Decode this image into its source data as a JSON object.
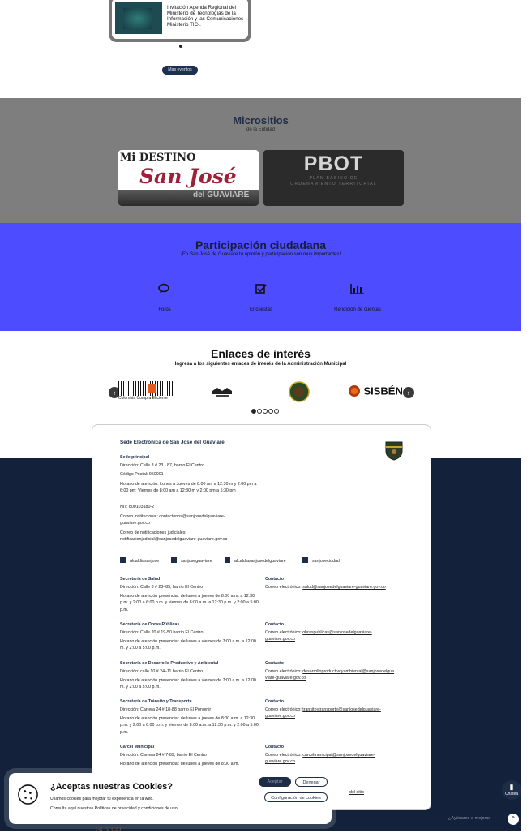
{
  "event": {
    "text": "Invitación Agenda Regional del Ministerio de Tecnologías de la Información y las Comunicaciones – Ministerio TIC-.",
    "more_label": "Mas eventos"
  },
  "microsites": {
    "title": "Micrositios",
    "subtitle": "de la Entidad",
    "card1": {
      "top": "Mi DESTINO",
      "main": "San José",
      "bottom": "del GUAVIARE"
    },
    "card2": {
      "main": "PBOT",
      "sub1": "PLAN BÁSICO DE",
      "sub2": "ORDENAMIENTO TERRITORIAL"
    }
  },
  "participation": {
    "title": "Participación ciudadana",
    "subtitle": "¡En San José de Guaviare tu opinión y participación son muy importantes!",
    "items": [
      {
        "icon": "chat-bubbles-icon",
        "label": "Foros"
      },
      {
        "icon": "checkbox-icon",
        "label": "Encuestas"
      },
      {
        "icon": "bar-chart-icon",
        "label": "Rendición de cuentas"
      }
    ]
  },
  "links": {
    "title": "Enlaces de interés",
    "subtitle": "Ingresa a los siguientes enlaces de interés de la Administración Municipal",
    "logo1": "Colombia Compra Eficiente",
    "logo4": "SISBÉN"
  },
  "footer": {
    "title": "Sede Electrónica de San José del Guaviare",
    "main_office": "Sede principal",
    "lines": [
      "Dirección: Calle 8 # 23 - 87, barrio El Centro",
      "Código Postal: 950001",
      "Horario de atención: Lunes a Jueves de 8:00 am a 12:30 m y 2:00 pm a 6:00 pm; Viernes de 8:00 am a 12:30 m y 2:00 pm a 5:30 pm",
      "NIT: 800103180-2",
      "Correo institucional: contactenos@sanjosedelguaviare-guaviare.gov.co",
      "Correo de notificaciones judiciales: notificacionjudicial@sanjosedelguaviare-guaviare.gov.co"
    ],
    "social": [
      "alcaldiasanjose",
      "sanjoseguaviare",
      "alcaldiasanjosedelguaviare",
      "sanjoseciudad"
    ],
    "offices": [
      {
        "name": "Secretaría de Salud",
        "address": "Dirección: Calle 8 # 23–85, barrio El Centro",
        "hours": "Horario de atención presencial: de lunes a jueves de 8:00 a.m. a 12:30 p.m. y 2:00 a 6:00 p.m. y viernes de 8:00 a.m. a 12:30 p.m. y 2:00 a 5:00 p.m.",
        "contact": "Contacto",
        "email_label": "Correo electrónico:",
        "email": "salud@sanjosedelguaviare-guaviare.gov.co"
      },
      {
        "name": "Secretaría de Obras Públicas",
        "address": "Dirección: Calle 20 # 19-50 barrio El Centro",
        "hours": "Horario de atención presencial: de lunes a viernes de 7:00 a.m. a 12:00 m. y 2:00 a 5:00 p.m.",
        "contact": "Contacto",
        "email_label": "Correo electrónico:",
        "email": "obraspublicas@sanjosedelguaviare-guaviare.gov.co"
      },
      {
        "name": "Secretaría de Desarrollo Productivo y Ambiental",
        "address": "Dirección: calle 10 # 24–11 barrio El Centro",
        "hours": "Horario de atención presencial: de lunes a viernes de 7:00 a.m. a 12:00 m. y 2:00 a 5:00 p.m.",
        "contact": "Contacto",
        "email_label": "Correo electrónico:",
        "email": "desarrolloproductivoyambiental@sanjosedelguaviare-guaviare.gov.co"
      },
      {
        "name": "Secretaría de Tránsito y Transporte",
        "address": "Dirección: Carrera 24 # 18-88 barrio El Porvenir",
        "hours": "Horario de atención presencial: de lunes a jueves de 8:00 a.m. a 12:30 p.m. y 2:00 a 6:00 p.m. y viernes de 8:00 a.m. a 12:30 p.m. y 2:00 a 5:00 p.m.",
        "contact": "Contacto",
        "email_label": "Correo electrónico:",
        "email": "transitoytransporte@sanjosedelguaviare-guaviare.gov.co"
      },
      {
        "name": "Cárcel Municipal",
        "address": "Dirección: Carrera 24 # 7-89, barrio El Centro",
        "hours": "Horario de atención presencial: de lunes a jueves de 8:00 a.m.",
        "contact": "Contacto",
        "email_label": "Correo electrónico:",
        "email": "carcelmunicipal@sanjosedelguaviare-guaviare.gov.co"
      }
    ],
    "site_link": "del sitio"
  },
  "cookies": {
    "title": "¿Aceptas nuestras Cookies?",
    "text1": "Usamos cookies para mejorar tu experiencia en la web.",
    "text2": "Consulta aquí nuestras Políticas de privacidad y condiciones de uso.",
    "accept": "Aceptar",
    "deny": "Denegar",
    "config": "Configuración de cookies"
  },
  "widgets": {
    "chat": "Chatea",
    "help": "¿Ayúdame a mejorar",
    "shelf": "GOV.CO"
  }
}
